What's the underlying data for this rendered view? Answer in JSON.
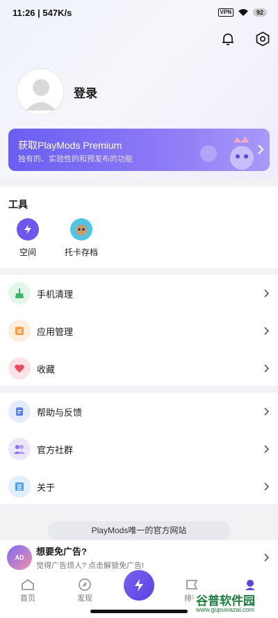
{
  "status_bar": {
    "time": "11:26",
    "network": "547K/s",
    "battery": "92",
    "vpn": "VPN"
  },
  "header": {
    "notification_icon": "bell-icon",
    "settings_icon": "gear-icon"
  },
  "profile": {
    "login_label": "登录"
  },
  "premium": {
    "title": "获取PlayMods Premium",
    "subtitle": "独有的、实验性的和预发布的功能"
  },
  "tools": {
    "title": "工具",
    "items": [
      {
        "label": "空间",
        "icon": "space-icon"
      },
      {
        "label": "托卡存档",
        "icon": "toca-save-icon"
      }
    ]
  },
  "menu_group_1": [
    {
      "label": "手机清理",
      "icon": "broom-icon"
    },
    {
      "label": "应用管理",
      "icon": "app-manage-icon"
    },
    {
      "label": "收藏",
      "icon": "heart-icon"
    }
  ],
  "menu_group_2": [
    {
      "label": "帮助与反馈",
      "icon": "help-icon"
    },
    {
      "label": "官方社群",
      "icon": "community-icon"
    },
    {
      "label": "关于",
      "icon": "about-icon"
    }
  ],
  "website_banner": "PlayMods唯一的官方网站",
  "ad": {
    "title": "想要免广告?",
    "subtitle": "觉得广告烦人? 点击解锁免广告!",
    "badge": "AD"
  },
  "tabbar": [
    {
      "label": "首页",
      "icon": "home-icon"
    },
    {
      "label": "发现",
      "icon": "compass-icon"
    },
    {
      "label": "排行",
      "icon": "ranking-icon"
    },
    {
      "label": "我的",
      "icon": "profile-icon"
    }
  ],
  "watermark": {
    "title": "谷普软件园",
    "url": "www.gupuxiazai.com"
  },
  "colors": {
    "accent": "#6b5ef1",
    "background": "#f2f2f4"
  }
}
